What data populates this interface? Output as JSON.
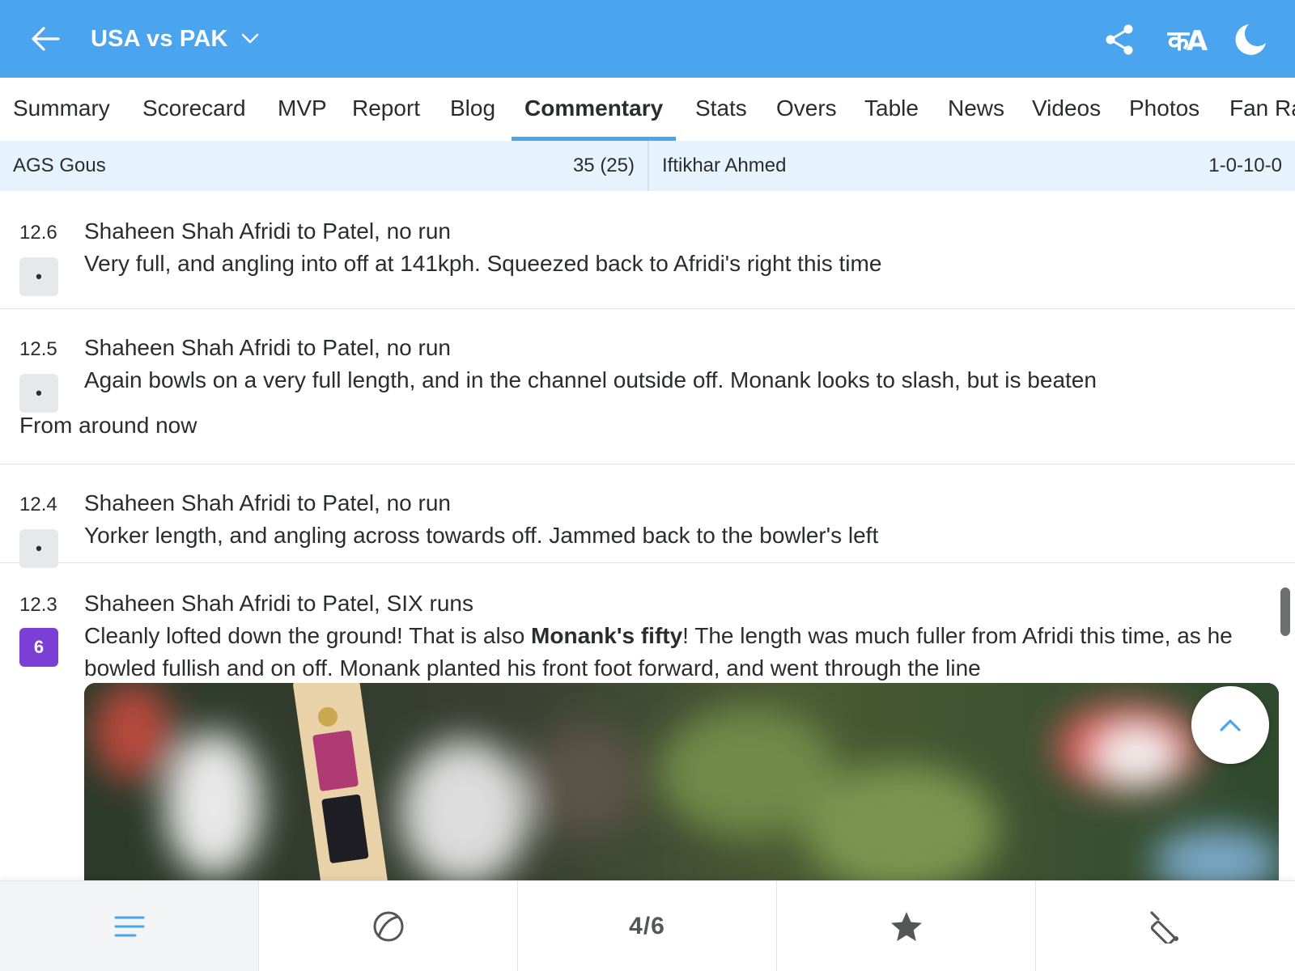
{
  "colors": {
    "header": "#4ba5ee",
    "tab_indicator": "#4ba5ee",
    "strip_bg": "#e6f3fc",
    "six_chip": "#7b3fd6"
  },
  "header": {
    "title": "USA vs PAK",
    "back_icon": "arrow-left-icon",
    "title_icon": "chevron-down-icon",
    "actions": [
      "share-icon",
      "language-icon",
      "dark-mode-icon"
    ],
    "language_glyph": "कA"
  },
  "tabs": [
    {
      "label": "Summary"
    },
    {
      "label": "Scorecard"
    },
    {
      "label": "MVP"
    },
    {
      "label": "Report"
    },
    {
      "label": "Blog"
    },
    {
      "label": "Commentary",
      "active": true
    },
    {
      "label": "Stats"
    },
    {
      "label": "Overs"
    },
    {
      "label": "Table"
    },
    {
      "label": "News"
    },
    {
      "label": "Videos"
    },
    {
      "label": "Photos"
    },
    {
      "label": "Fan Ra"
    }
  ],
  "strip": {
    "batter_name": "AGS Gous",
    "batter_score": "35 (25)",
    "bowler_name": "Iftikhar Ahmed",
    "bowler_figures": "1-0-10-0"
  },
  "commentary": [
    {
      "over": "12.6",
      "ball": "•",
      "headline": "Shaheen Shah Afridi to Patel, no run",
      "text": "Very full, and angling into off at 141kph. Squeezed back to Afridi's right this time"
    },
    {
      "over": "12.5",
      "ball": "•",
      "headline": "Shaheen Shah Afridi to Patel, no run",
      "text": "Again bowls on a very full length, and in the channel outside off. Monank looks to slash, but is beaten",
      "note": "From around now"
    },
    {
      "over": "12.4",
      "ball": "•",
      "headline": "Shaheen Shah Afridi to Patel, no run",
      "text": "Yorker length, and angling across towards off. Jammed back to the bowler's left"
    },
    {
      "over": "12.3",
      "ball": "6",
      "headline": "Shaheen Shah Afridi to Patel, SIX runs",
      "text_before": "Cleanly lofted down the ground! That is also ",
      "text_bold": "Monank's fifty",
      "text_after": "! The length was much fuller from Afridi this time, as he bowled fullish and on off. Monank planted his front foot forward, and went through the line"
    }
  ],
  "scroll_top_icon": "chevron-up-icon",
  "bottom_nav": [
    {
      "icon": "menu-lines-icon",
      "active": true
    },
    {
      "icon": "ball-icon"
    },
    {
      "label": "4/6"
    },
    {
      "icon": "star-icon"
    },
    {
      "icon": "cricket-bat-icon"
    }
  ]
}
